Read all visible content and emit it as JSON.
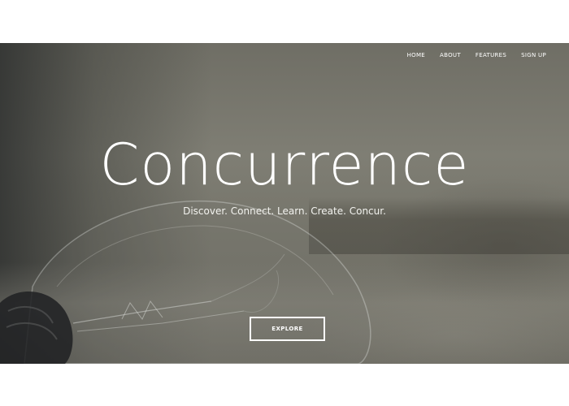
{
  "nav": {
    "items": [
      {
        "label": "HOME"
      },
      {
        "label": "ABOUT"
      },
      {
        "label": "FEATURES"
      },
      {
        "label": "SIGN UP"
      }
    ]
  },
  "hero": {
    "title": "Concurrence",
    "tagline": "Discover. Connect. Learn. Create. Concur.",
    "cta_label": "EXPLORE",
    "background_image": "light-bulb-photo"
  },
  "colors": {
    "page_background": "#ffffff",
    "hero_overlay": "#76756b",
    "text": "#ffffff"
  }
}
